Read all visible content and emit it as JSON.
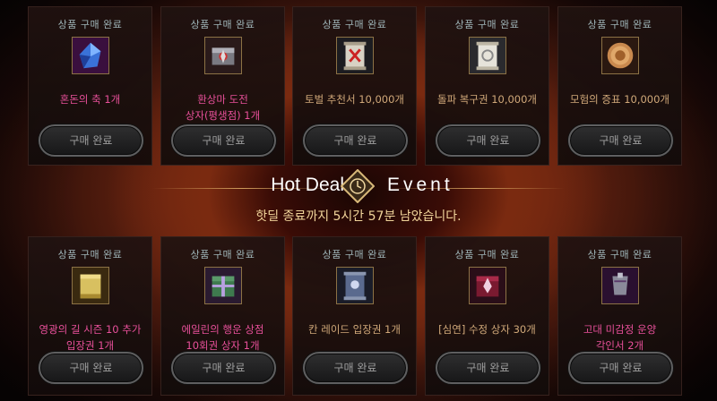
{
  "banner": {
    "title_left": "Hot Deal",
    "title_right": "Event",
    "timer_text": "핫딜 종료까지 5시간 57분 남았습니다.",
    "clock_icon": "clock-icon"
  },
  "status_label": "상품 구매 완료",
  "button_label": "구매 완료",
  "colors": {
    "item_name": "#d0a879",
    "item_name_pink": "#e8509a",
    "status": "#9fb5b8"
  },
  "top_row": [
    {
      "name": "혼돈의 축 1개",
      "icon": "blue-crystal-icon",
      "pink": true
    },
    {
      "name": "환상마 도전\n상자(평생점) 1개",
      "icon": "silver-box-icon",
      "pink": true
    },
    {
      "name": "토벌 추천서 10,000개",
      "icon": "scroll-red-icon",
      "pink": false
    },
    {
      "name": "돌파 복구권 10,000개",
      "icon": "scroll-white-icon",
      "pink": false
    },
    {
      "name": "모험의 증표 10,000개",
      "icon": "gold-coin-icon",
      "pink": false
    }
  ],
  "bottom_row": [
    {
      "name": "영광의 길 시즌 10 추가\n입장권 1개",
      "icon": "gold-ticket-icon",
      "pink": true
    },
    {
      "name": "에일린의 행운 상점\n10회권 상자 1개",
      "icon": "gift-box-icon",
      "pink": true
    },
    {
      "name": "칸 레이드 입장권 1개",
      "icon": "dark-scroll-icon",
      "pink": false
    },
    {
      "name": "[심연] 수정 상자 30개",
      "icon": "crystal-box-icon",
      "pink": false
    },
    {
      "name": "고대 미감정 운양\n각인서 2개",
      "icon": "armor-set-icon",
      "pink": true
    }
  ]
}
